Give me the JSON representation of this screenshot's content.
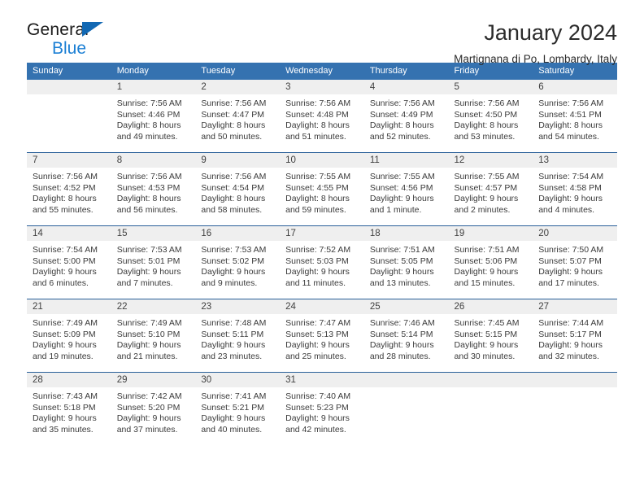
{
  "brand": {
    "name_part1": "General",
    "name_part2": "Blue",
    "triangle_color": "#1268b3",
    "blue_color": "#1b7fd4"
  },
  "header": {
    "title": "January 2024",
    "subtitle": "Martignana di Po, Lombardy, Italy"
  },
  "theme": {
    "header_bg": "#3572b0",
    "daynum_bg": "#efefef",
    "row_divider": "#2a6099"
  },
  "calendar": {
    "weekday_headers": [
      "Sunday",
      "Monday",
      "Tuesday",
      "Wednesday",
      "Thursday",
      "Friday",
      "Saturday"
    ],
    "weeks": [
      [
        {
          "day": "",
          "sunrise": "",
          "sunset": "",
          "daylight_line1": "",
          "daylight_line2": ""
        },
        {
          "day": "1",
          "sunrise": "Sunrise: 7:56 AM",
          "sunset": "Sunset: 4:46 PM",
          "daylight_line1": "Daylight: 8 hours",
          "daylight_line2": "and 49 minutes."
        },
        {
          "day": "2",
          "sunrise": "Sunrise: 7:56 AM",
          "sunset": "Sunset: 4:47 PM",
          "daylight_line1": "Daylight: 8 hours",
          "daylight_line2": "and 50 minutes."
        },
        {
          "day": "3",
          "sunrise": "Sunrise: 7:56 AM",
          "sunset": "Sunset: 4:48 PM",
          "daylight_line1": "Daylight: 8 hours",
          "daylight_line2": "and 51 minutes."
        },
        {
          "day": "4",
          "sunrise": "Sunrise: 7:56 AM",
          "sunset": "Sunset: 4:49 PM",
          "daylight_line1": "Daylight: 8 hours",
          "daylight_line2": "and 52 minutes."
        },
        {
          "day": "5",
          "sunrise": "Sunrise: 7:56 AM",
          "sunset": "Sunset: 4:50 PM",
          "daylight_line1": "Daylight: 8 hours",
          "daylight_line2": "and 53 minutes."
        },
        {
          "day": "6",
          "sunrise": "Sunrise: 7:56 AM",
          "sunset": "Sunset: 4:51 PM",
          "daylight_line1": "Daylight: 8 hours",
          "daylight_line2": "and 54 minutes."
        }
      ],
      [
        {
          "day": "7",
          "sunrise": "Sunrise: 7:56 AM",
          "sunset": "Sunset: 4:52 PM",
          "daylight_line1": "Daylight: 8 hours",
          "daylight_line2": "and 55 minutes."
        },
        {
          "day": "8",
          "sunrise": "Sunrise: 7:56 AM",
          "sunset": "Sunset: 4:53 PM",
          "daylight_line1": "Daylight: 8 hours",
          "daylight_line2": "and 56 minutes."
        },
        {
          "day": "9",
          "sunrise": "Sunrise: 7:56 AM",
          "sunset": "Sunset: 4:54 PM",
          "daylight_line1": "Daylight: 8 hours",
          "daylight_line2": "and 58 minutes."
        },
        {
          "day": "10",
          "sunrise": "Sunrise: 7:55 AM",
          "sunset": "Sunset: 4:55 PM",
          "daylight_line1": "Daylight: 8 hours",
          "daylight_line2": "and 59 minutes."
        },
        {
          "day": "11",
          "sunrise": "Sunrise: 7:55 AM",
          "sunset": "Sunset: 4:56 PM",
          "daylight_line1": "Daylight: 9 hours",
          "daylight_line2": "and 1 minute."
        },
        {
          "day": "12",
          "sunrise": "Sunrise: 7:55 AM",
          "sunset": "Sunset: 4:57 PM",
          "daylight_line1": "Daylight: 9 hours",
          "daylight_line2": "and 2 minutes."
        },
        {
          "day": "13",
          "sunrise": "Sunrise: 7:54 AM",
          "sunset": "Sunset: 4:58 PM",
          "daylight_line1": "Daylight: 9 hours",
          "daylight_line2": "and 4 minutes."
        }
      ],
      [
        {
          "day": "14",
          "sunrise": "Sunrise: 7:54 AM",
          "sunset": "Sunset: 5:00 PM",
          "daylight_line1": "Daylight: 9 hours",
          "daylight_line2": "and 6 minutes."
        },
        {
          "day": "15",
          "sunrise": "Sunrise: 7:53 AM",
          "sunset": "Sunset: 5:01 PM",
          "daylight_line1": "Daylight: 9 hours",
          "daylight_line2": "and 7 minutes."
        },
        {
          "day": "16",
          "sunrise": "Sunrise: 7:53 AM",
          "sunset": "Sunset: 5:02 PM",
          "daylight_line1": "Daylight: 9 hours",
          "daylight_line2": "and 9 minutes."
        },
        {
          "day": "17",
          "sunrise": "Sunrise: 7:52 AM",
          "sunset": "Sunset: 5:03 PM",
          "daylight_line1": "Daylight: 9 hours",
          "daylight_line2": "and 11 minutes."
        },
        {
          "day": "18",
          "sunrise": "Sunrise: 7:51 AM",
          "sunset": "Sunset: 5:05 PM",
          "daylight_line1": "Daylight: 9 hours",
          "daylight_line2": "and 13 minutes."
        },
        {
          "day": "19",
          "sunrise": "Sunrise: 7:51 AM",
          "sunset": "Sunset: 5:06 PM",
          "daylight_line1": "Daylight: 9 hours",
          "daylight_line2": "and 15 minutes."
        },
        {
          "day": "20",
          "sunrise": "Sunrise: 7:50 AM",
          "sunset": "Sunset: 5:07 PM",
          "daylight_line1": "Daylight: 9 hours",
          "daylight_line2": "and 17 minutes."
        }
      ],
      [
        {
          "day": "21",
          "sunrise": "Sunrise: 7:49 AM",
          "sunset": "Sunset: 5:09 PM",
          "daylight_line1": "Daylight: 9 hours",
          "daylight_line2": "and 19 minutes."
        },
        {
          "day": "22",
          "sunrise": "Sunrise: 7:49 AM",
          "sunset": "Sunset: 5:10 PM",
          "daylight_line1": "Daylight: 9 hours",
          "daylight_line2": "and 21 minutes."
        },
        {
          "day": "23",
          "sunrise": "Sunrise: 7:48 AM",
          "sunset": "Sunset: 5:11 PM",
          "daylight_line1": "Daylight: 9 hours",
          "daylight_line2": "and 23 minutes."
        },
        {
          "day": "24",
          "sunrise": "Sunrise: 7:47 AM",
          "sunset": "Sunset: 5:13 PM",
          "daylight_line1": "Daylight: 9 hours",
          "daylight_line2": "and 25 minutes."
        },
        {
          "day": "25",
          "sunrise": "Sunrise: 7:46 AM",
          "sunset": "Sunset: 5:14 PM",
          "daylight_line1": "Daylight: 9 hours",
          "daylight_line2": "and 28 minutes."
        },
        {
          "day": "26",
          "sunrise": "Sunrise: 7:45 AM",
          "sunset": "Sunset: 5:15 PM",
          "daylight_line1": "Daylight: 9 hours",
          "daylight_line2": "and 30 minutes."
        },
        {
          "day": "27",
          "sunrise": "Sunrise: 7:44 AM",
          "sunset": "Sunset: 5:17 PM",
          "daylight_line1": "Daylight: 9 hours",
          "daylight_line2": "and 32 minutes."
        }
      ],
      [
        {
          "day": "28",
          "sunrise": "Sunrise: 7:43 AM",
          "sunset": "Sunset: 5:18 PM",
          "daylight_line1": "Daylight: 9 hours",
          "daylight_line2": "and 35 minutes."
        },
        {
          "day": "29",
          "sunrise": "Sunrise: 7:42 AM",
          "sunset": "Sunset: 5:20 PM",
          "daylight_line1": "Daylight: 9 hours",
          "daylight_line2": "and 37 minutes."
        },
        {
          "day": "30",
          "sunrise": "Sunrise: 7:41 AM",
          "sunset": "Sunset: 5:21 PM",
          "daylight_line1": "Daylight: 9 hours",
          "daylight_line2": "and 40 minutes."
        },
        {
          "day": "31",
          "sunrise": "Sunrise: 7:40 AM",
          "sunset": "Sunset: 5:23 PM",
          "daylight_line1": "Daylight: 9 hours",
          "daylight_line2": "and 42 minutes."
        },
        {
          "day": "",
          "sunrise": "",
          "sunset": "",
          "daylight_line1": "",
          "daylight_line2": ""
        },
        {
          "day": "",
          "sunrise": "",
          "sunset": "",
          "daylight_line1": "",
          "daylight_line2": ""
        },
        {
          "day": "",
          "sunrise": "",
          "sunset": "",
          "daylight_line1": "",
          "daylight_line2": ""
        }
      ]
    ]
  }
}
